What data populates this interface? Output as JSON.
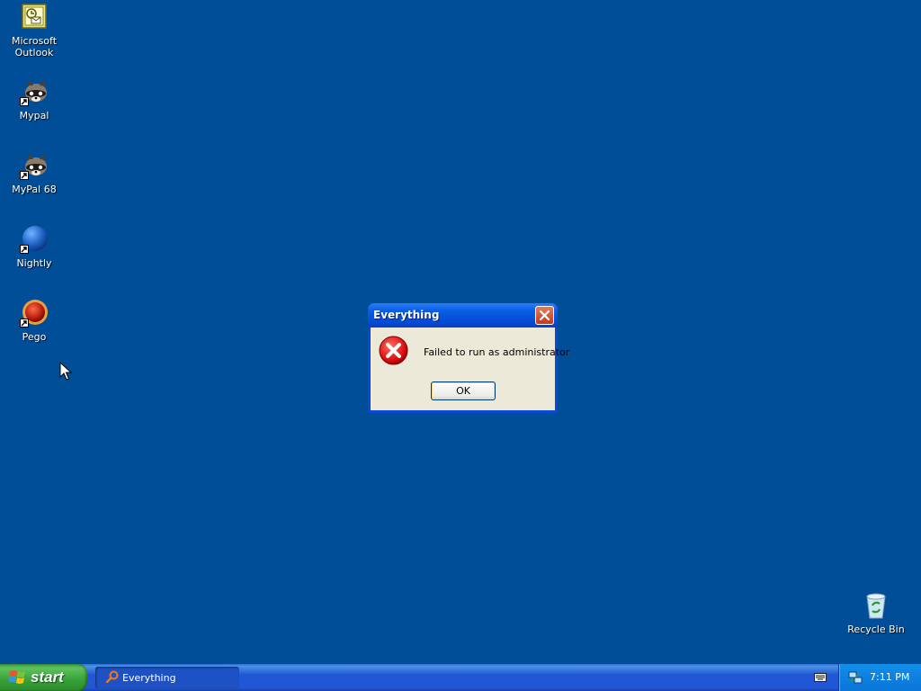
{
  "desktop": {
    "background_color": "#004e98",
    "icons": [
      {
        "label": "Microsoft Outlook",
        "icon": "outlook-icon"
      },
      {
        "label": "Mypal",
        "icon": "raccoon-icon"
      },
      {
        "label": "MyPal 68",
        "icon": "raccoon-icon"
      },
      {
        "label": "Nightly",
        "icon": "globe-icon"
      },
      {
        "label": "Pego",
        "icon": "red-orb-icon"
      }
    ],
    "recycle_bin": {
      "label": "Recycle Bin",
      "icon": "recycle-bin-icon"
    }
  },
  "dialog": {
    "title": "Everything",
    "message": "Failed to run as administrator",
    "ok_label": "OK",
    "icon": "error-icon"
  },
  "taskbar": {
    "start_label": "start",
    "tasks": [
      {
        "label": "Everything",
        "icon": "search-icon"
      }
    ],
    "clock": "7:11 PM"
  }
}
